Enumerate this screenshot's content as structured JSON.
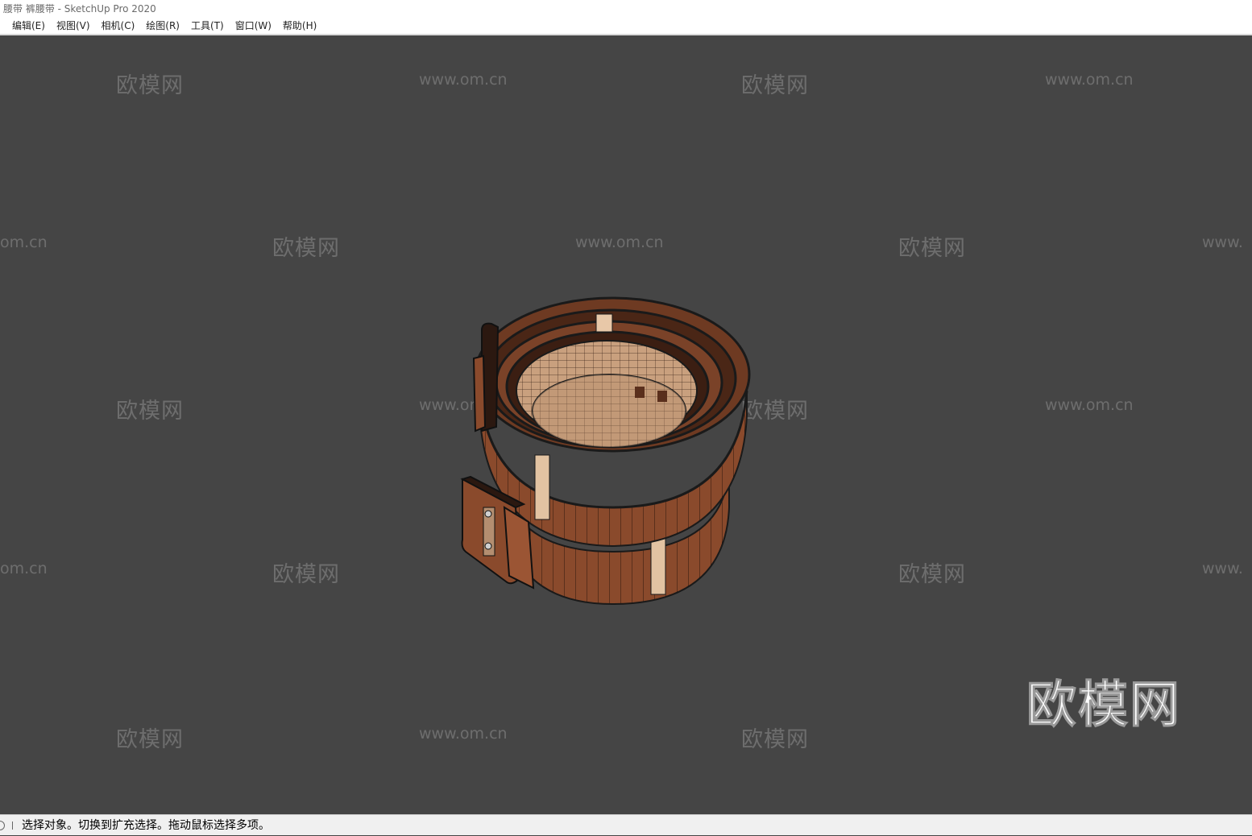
{
  "window": {
    "title": "腰带 裤腰带 - SketchUp Pro 2020"
  },
  "menu": {
    "items": [
      "编辑(E)",
      "视图(V)",
      "相机(C)",
      "绘图(R)",
      "工具(T)",
      "窗口(W)",
      "帮助(H)"
    ]
  },
  "watermark": {
    "brand": "欧模网",
    "url": "www.om.cn",
    "url_partial": "om.cn",
    "url_cut": "www.",
    "big": "欧模网"
  },
  "status": {
    "text": "选择对象。切换到扩充选择。拖动鼠标选择多项。"
  },
  "colors": {
    "viewport_bg": "#454545",
    "belt_outer": "#8a4a2c",
    "belt_inner": "#c59a78",
    "edge": "#1a1a1a"
  }
}
